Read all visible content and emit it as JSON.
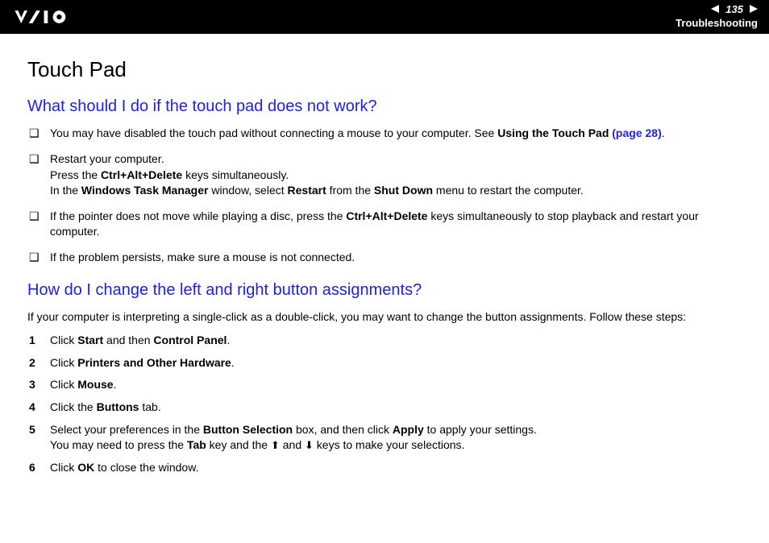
{
  "header": {
    "page_number": "135",
    "section": "Troubleshooting"
  },
  "title": "Touch Pad",
  "q1": {
    "heading": "What should I do if the touch pad does not work?",
    "bullets": {
      "b1_pre": "You may have disabled the touch pad without connecting a mouse to your computer. See ",
      "b1_bold": "Using the Touch Pad ",
      "b1_link": "(page 28)",
      "b1_post": ".",
      "b2_l1": "Restart your computer.",
      "b2_l2a": "Press the ",
      "b2_l2b": "Ctrl+Alt+Delete",
      "b2_l2c": " keys simultaneously.",
      "b2_l3a": "In the ",
      "b2_l3b": "Windows Task Manager",
      "b2_l3c": " window, select ",
      "b2_l3d": "Restart",
      "b2_l3e": " from the ",
      "b2_l3f": "Shut Down",
      "b2_l3g": " menu to restart the computer.",
      "b3a": "If the pointer does not move while playing a disc, press the ",
      "b3b": "Ctrl+Alt+Delete",
      "b3c": " keys simultaneously to stop playback and restart your computer.",
      "b4": "If the problem persists, make sure a mouse is not connected."
    }
  },
  "q2": {
    "heading": "How do I change the left and right button assignments?",
    "intro": "If your computer is interpreting a single-click as a double-click, you may want to change the button assignments. Follow these steps:",
    "steps": {
      "n1": "1",
      "s1a": "Click ",
      "s1b": "Start",
      "s1c": " and then ",
      "s1d": "Control Panel",
      "s1e": ".",
      "n2": "2",
      "s2a": "Click ",
      "s2b": "Printers and Other Hardware",
      "s2c": ".",
      "n3": "3",
      "s3a": "Click ",
      "s3b": "Mouse",
      "s3c": ".",
      "n4": "4",
      "s4a": "Click the ",
      "s4b": "Buttons",
      "s4c": " tab.",
      "n5": "5",
      "s5a": "Select your preferences in the ",
      "s5b": "Button Selection",
      "s5c": " box, and then click ",
      "s5d": "Apply",
      "s5e": " to apply your settings.",
      "s5f": "You may need to press the ",
      "s5g": "Tab",
      "s5h": " key and the ",
      "s5up": "⬆",
      "s5i": " and ",
      "s5dn": "⬇",
      "s5j": " keys to make your selections.",
      "n6": "6",
      "s6a": "Click ",
      "s6b": "OK",
      "s6c": " to close the window."
    }
  }
}
